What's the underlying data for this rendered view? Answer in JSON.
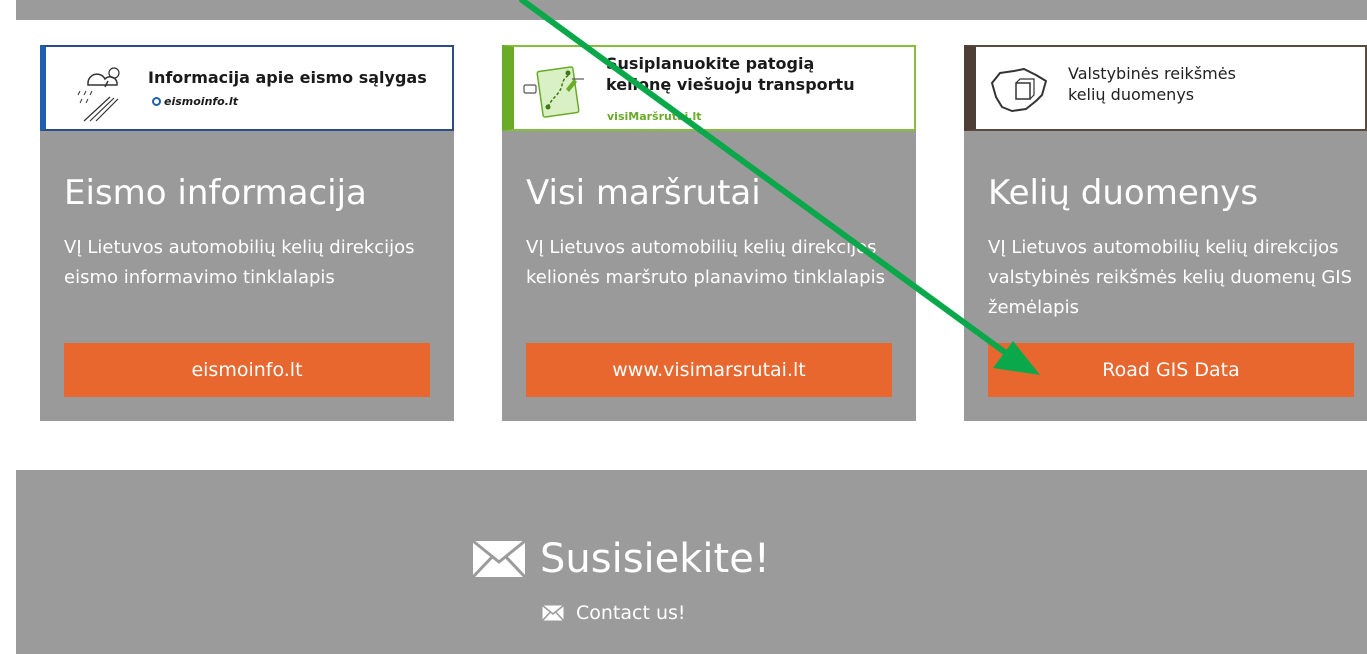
{
  "cards": [
    {
      "banner_title": "Informacija apie eismo sąlygas",
      "banner_sub": "eismoinfo.lt",
      "banner_color": "#1f5fad",
      "icon": "weather-road-icon",
      "title": "Eismo informacija",
      "description": "VĮ Lietuvos automobilių kelių direkcijos eismo informavimo tinklalapis",
      "button": "eismoinfo.lt"
    },
    {
      "banner_title": "Susiplanuokite patogią\nkelionę viešuoju transportu",
      "banner_sub": "visiMaršrutai.lt",
      "banner_color": "#6aab27",
      "icon": "route-map-icon",
      "title": "Visi maršrutai",
      "description": "VĮ Lietuvos automobilių kelių direkcijos kelionės maršruto planavimo tinklalapis",
      "button": "www.visimarsrutai.lt"
    },
    {
      "banner_title": "Valstybinės reikšmės\nkelių duomenys",
      "banner_color": "#4d3f35",
      "icon": "lithuania-map-icon",
      "title": "Kelių duomenys",
      "description": "VĮ Lietuvos automobilių kelių direkcijos valstybinės reikšmės kelių duomenų GIS žemėlapis",
      "button": "Road GIS Data"
    }
  ],
  "contact": {
    "title": "Susisiekite!",
    "link": "Contact us!",
    "icon": "envelope-icon"
  },
  "colors": {
    "card_bg": "#9a9a9a",
    "button_bg": "#e8672e",
    "annotation_arrow": "#0aa84a"
  }
}
